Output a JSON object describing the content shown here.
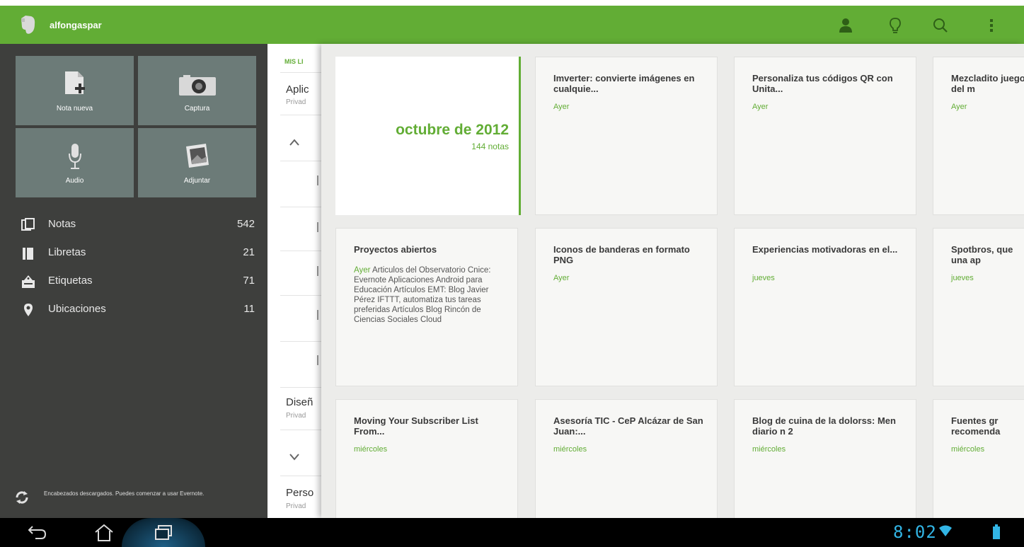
{
  "header": {
    "username": "alfongaspar",
    "accent_color": "#62ad35",
    "icons": [
      "account-icon",
      "lightbulb-icon",
      "search-icon",
      "overflow-menu-icon"
    ]
  },
  "quick_actions": [
    {
      "label": "Nota nueva",
      "icon": "new-note-icon"
    },
    {
      "label": "Captura",
      "icon": "camera-icon"
    },
    {
      "label": "Audio",
      "icon": "microphone-icon"
    },
    {
      "label": "Adjuntar",
      "icon": "attach-icon"
    }
  ],
  "nav": [
    {
      "label": "Notas",
      "count": "542",
      "icon": "notes-icon"
    },
    {
      "label": "Libretas",
      "count": "21",
      "icon": "notebook-icon"
    },
    {
      "label": "Etiquetas",
      "count": "71",
      "icon": "tag-icon"
    },
    {
      "label": "Ubicaciones",
      "count": "11",
      "icon": "location-pin-icon"
    }
  ],
  "status": {
    "text": "Encabezados descargados. Puedes comenzar a usar Evernote.",
    "icon": "sync-icon"
  },
  "notebooks_column": {
    "header": "MIS LI",
    "items": [
      {
        "title": "Aplic",
        "subtitle": "Privad"
      },
      {
        "title": "Diseñ",
        "subtitle": "Privad"
      },
      {
        "title": "Perso",
        "subtitle": "Privad"
      }
    ]
  },
  "month_group": {
    "month": "octubre de 2012",
    "count": "144 notas"
  },
  "notes": [
    {
      "title": "Imverter: convierte imágenes en cualquie...",
      "date": "Ayer",
      "body": ""
    },
    {
      "title": "Personaliza tus códigos QR con Unita...",
      "date": "Ayer",
      "body": ""
    },
    {
      "title": "Mezcladito juego del m",
      "date": "Ayer",
      "body": ""
    },
    {
      "title": "Proyectos abiertos",
      "date": "Ayer",
      "body": "Articulos del Observatorio Cnice: Evernote Aplicaciones Android para Educación Artículos EMT: Blog Javier Pérez IFTTT, automatiza tus tareas preferidas Artículos Blog Rincón de Ciencias Sociales Cloud"
    },
    {
      "title": "Iconos de banderas en formato PNG",
      "date": "Ayer",
      "body": ""
    },
    {
      "title": "Experiencias motivadoras en el...",
      "date": "jueves",
      "body": ""
    },
    {
      "title": "Spotbros, que una ap",
      "date": "jueves",
      "body": ""
    },
    {
      "title": "Moving Your Subscriber List From...",
      "date": "miércoles",
      "body": ""
    },
    {
      "title": "Asesoría TIC - CeP Alcázar de San Juan:...",
      "date": "miércoles",
      "body": ""
    },
    {
      "title": "Blog de cuina de la dolorss: Men diario n 2",
      "date": "miércoles",
      "body": ""
    },
    {
      "title": "Fuentes gr recomenda",
      "date": "miércoles",
      "body": ""
    }
  ],
  "system_bar": {
    "time": "8:02",
    "accent_color": "#32b5e5",
    "icons": [
      "back-icon",
      "home-icon",
      "recent-apps-icon",
      "wifi-icon",
      "battery-icon"
    ]
  }
}
